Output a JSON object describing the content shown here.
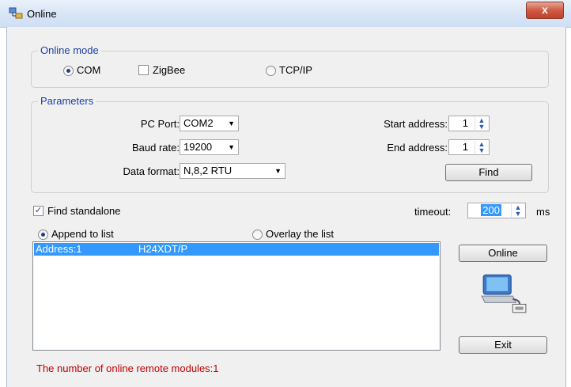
{
  "window": {
    "title": "Online",
    "close_label": "x",
    "app_icon": "network-computers-icon"
  },
  "online_mode": {
    "legend": "Online mode",
    "options": [
      {
        "label": "COM",
        "type": "radio",
        "selected": true
      },
      {
        "label": "ZigBee",
        "type": "checkbox",
        "checked": false
      },
      {
        "label": "TCP/IP",
        "type": "radio",
        "selected": false
      }
    ]
  },
  "parameters": {
    "legend": "Parameters",
    "pc_port": {
      "label": "PC Port:",
      "value": "COM2"
    },
    "baud_rate": {
      "label": "Baud rate:",
      "value": "19200"
    },
    "data_format": {
      "label": "Data format:",
      "value": "N,8,2 RTU"
    },
    "start_address": {
      "label": "Start address:",
      "value": "1"
    },
    "end_address": {
      "label": "End address:",
      "value": "1"
    },
    "find_label": "Find"
  },
  "find_standalone": {
    "label": "Find standalone",
    "checked": true
  },
  "timeout": {
    "label": "timeout:",
    "value": "200",
    "unit": "ms"
  },
  "list_mode": {
    "append": {
      "label": "Append to list",
      "selected": true
    },
    "overlay": {
      "label": "Overlay the list",
      "selected": false
    }
  },
  "results": [
    {
      "address": "Address:1",
      "module": "H24XDT/P",
      "selected": true
    }
  ],
  "buttons": {
    "online": "Online",
    "exit": "Exit"
  },
  "status": "The number of online remote modules:1",
  "colors": {
    "legend": "#1c3ea6",
    "selection": "#3399ff",
    "status": "#c00000"
  }
}
